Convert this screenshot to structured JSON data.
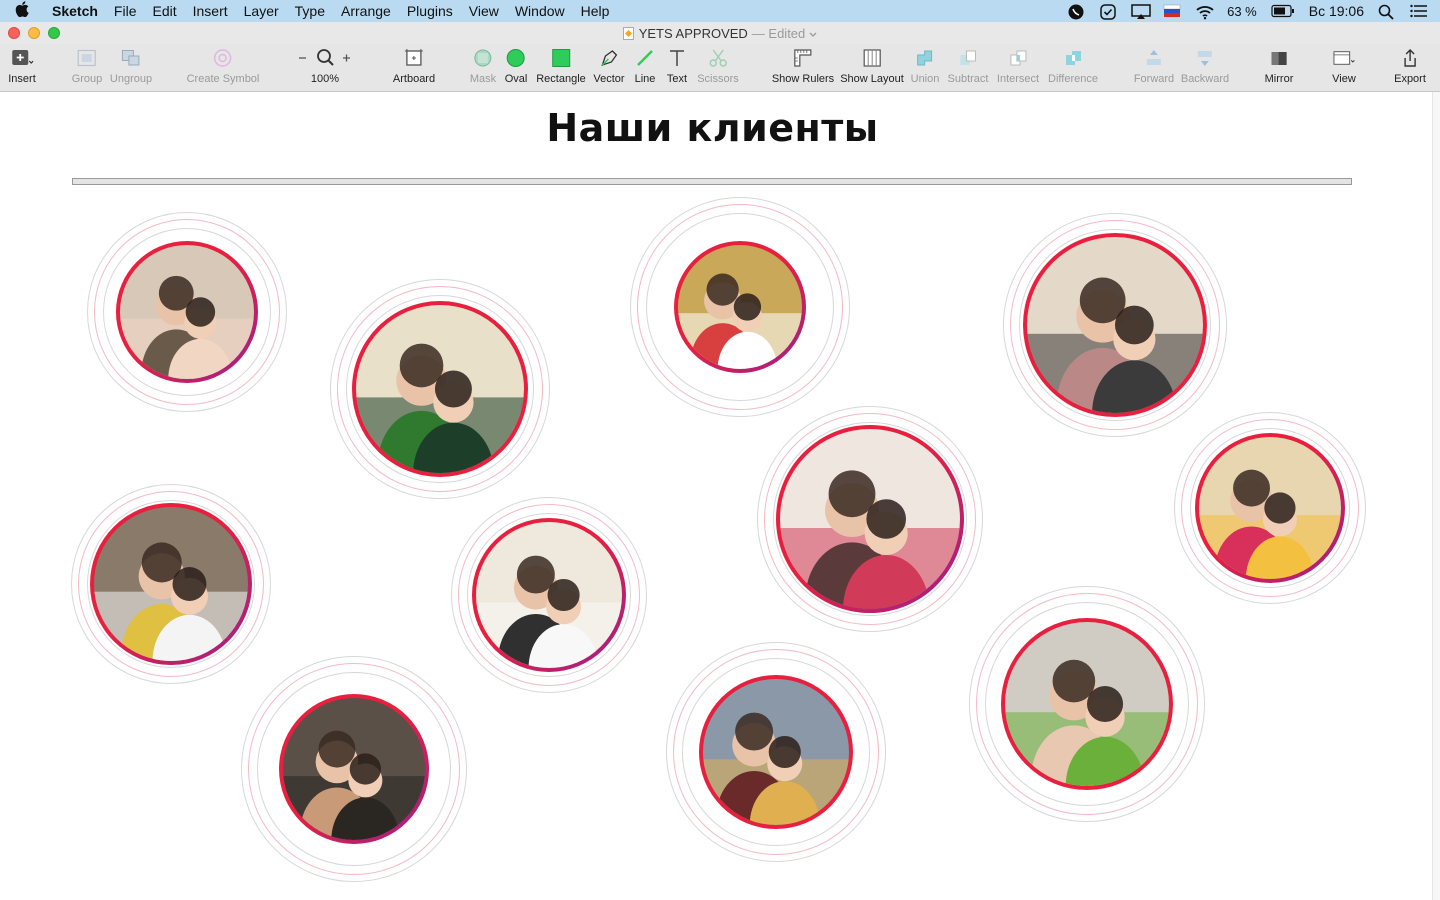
{
  "menubar": {
    "app_name": "Sketch",
    "items": [
      "File",
      "Edit",
      "Insert",
      "Layer",
      "Type",
      "Arrange",
      "Plugins",
      "View",
      "Window",
      "Help"
    ],
    "battery": "63 %",
    "clock": "Вс 19:06"
  },
  "window": {
    "title": "YETS APPROVED",
    "status": "— Edited"
  },
  "toolbar": {
    "insert": "Insert",
    "group": "Group",
    "ungroup": "Ungroup",
    "create_symbol": "Create Symbol",
    "zoom": "100%",
    "artboard": "Artboard",
    "mask": "Mask",
    "oval": "Oval",
    "rectangle": "Rectangle",
    "vector": "Vector",
    "line": "Line",
    "text": "Text",
    "scissors": "Scissors",
    "show_rulers": "Show Rulers",
    "show_layout": "Show Layout",
    "union": "Union",
    "subtract": "Subtract",
    "intersect": "Intersect",
    "difference": "Difference",
    "forward": "Forward",
    "backward": "Backward",
    "mirror": "Mirror",
    "view": "View",
    "export": "Export"
  },
  "canvas": {
    "heading": "Наши клиенты",
    "ring_colors": {
      "red": "#e8203f",
      "purple": "#9b1f8c",
      "halo": "#d7d7d7"
    },
    "clients": [
      {
        "id": "client-1",
        "photo": "selfie-man-and-girl",
        "palette": [
          "#d8c8b8",
          "#6a5a4a",
          "#f2d6c4"
        ]
      },
      {
        "id": "client-2",
        "photo": "man-holding-girl-green",
        "palette": [
          "#e8e0c8",
          "#2f7a2f",
          "#1d3f2a"
        ]
      },
      {
        "id": "client-3",
        "photo": "teacher-with-kids-classroom",
        "palette": [
          "#c9a85a",
          "#d84040",
          "#ffffff"
        ]
      },
      {
        "id": "client-4",
        "photo": "woman-with-two-kids",
        "palette": [
          "#e4d8c8",
          "#b88",
          "#3b3b3b"
        ]
      },
      {
        "id": "client-5",
        "photo": "woman-and-girl-on-sofa",
        "palette": [
          "#efe6e0",
          "#5a3a3a",
          "#d23a5a"
        ]
      },
      {
        "id": "client-6",
        "photo": "playroom-teacher",
        "palette": [
          "#e7d6b0",
          "#d8305a",
          "#f4c040"
        ]
      },
      {
        "id": "client-7",
        "photo": "classroom-floor-kids",
        "palette": [
          "#8a7a6a",
          "#e0c040",
          "#f4f4f4"
        ]
      },
      {
        "id": "client-8",
        "photo": "group-with-children",
        "palette": [
          "#efe8dc",
          "#303030",
          "#f8f8f8"
        ]
      },
      {
        "id": "client-9",
        "photo": "man-portrait",
        "palette": [
          "#5a5048",
          "#c89a78",
          "#2a2622"
        ]
      },
      {
        "id": "client-10",
        "photo": "woman-hugging-boy",
        "palette": [
          "#8a98a8",
          "#6a2a2a",
          "#e0b050"
        ]
      },
      {
        "id": "client-11",
        "photo": "woman-and-girl-peace-sign",
        "palette": [
          "#d0ccc4",
          "#e8c8b0",
          "#6ab03a"
        ]
      }
    ]
  }
}
